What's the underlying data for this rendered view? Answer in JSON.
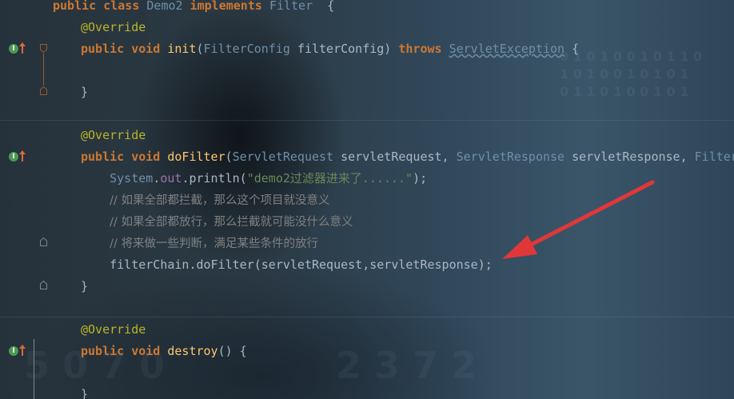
{
  "editor": {
    "lines": [
      {
        "tokens": [
          [
            "kw",
            "public "
          ],
          [
            "kw",
            "class "
          ],
          [
            "typ",
            "Demo2 "
          ],
          [
            "kw",
            "implements "
          ],
          [
            "typ",
            "Filter"
          ],
          [
            "",
            "  {"
          ]
        ]
      },
      {
        "tokens": [
          [
            "ann",
            "@Override"
          ]
        ]
      },
      {
        "tokens": [
          [
            "kw",
            "public "
          ],
          [
            "kw",
            "void "
          ],
          [
            "mth",
            "init"
          ],
          [
            "",
            "("
          ],
          [
            "typ",
            "FilterConfig "
          ],
          [
            "",
            "filterConfig) "
          ],
          [
            "kw",
            "throws "
          ],
          [
            "typ ul",
            "ServletException"
          ],
          [
            "",
            " {"
          ]
        ]
      },
      {
        "tokens": [
          [
            "",
            ""
          ]
        ]
      },
      {
        "tokens": [
          [
            "",
            "}"
          ]
        ]
      },
      {
        "tokens": [
          [
            "",
            ""
          ]
        ]
      },
      {
        "tokens": [
          [
            "ann",
            "@Override"
          ]
        ]
      },
      {
        "tokens": [
          [
            "kw",
            "public "
          ],
          [
            "kw",
            "void "
          ],
          [
            "mth",
            "doFilter"
          ],
          [
            "",
            "("
          ],
          [
            "typ",
            "ServletRequest "
          ],
          [
            "",
            "servletRequest, "
          ],
          [
            "typ",
            "ServletResponse "
          ],
          [
            "",
            "servletResponse, "
          ],
          [
            "typ",
            "FilterChain filterChain"
          ]
        ]
      },
      {
        "tokens": [
          [
            "",
            "    "
          ],
          [
            "typ",
            "System"
          ],
          [
            "",
            "."
          ],
          [
            "fld",
            "out"
          ],
          [
            "",
            ".println("
          ],
          [
            "str",
            "\"demo2过滤器进来了......\""
          ],
          [
            "",
            ");"
          ]
        ]
      },
      {
        "tokens": [
          [
            "",
            "    "
          ],
          [
            "cmt",
            "// 如果全部都拦截，那么这个项目就没意义"
          ]
        ]
      },
      {
        "tokens": [
          [
            "",
            "    "
          ],
          [
            "cmt",
            "// 如果全部都放行，那么拦截就可能没什么意义"
          ]
        ]
      },
      {
        "tokens": [
          [
            "",
            "    "
          ],
          [
            "cmt",
            "// 将来做一些判断，满足某些条件的放行"
          ]
        ]
      },
      {
        "tokens": [
          [
            "",
            "    filterChain.doFilter(servletRequest,servletResponse);"
          ]
        ]
      },
      {
        "tokens": [
          [
            "",
            "}"
          ]
        ]
      },
      {
        "tokens": [
          [
            "",
            ""
          ]
        ]
      },
      {
        "tokens": [
          [
            "ann",
            "@Override"
          ]
        ]
      },
      {
        "tokens": [
          [
            "kw",
            "public "
          ],
          [
            "kw",
            "void "
          ],
          [
            "mth",
            "destroy"
          ],
          [
            "",
            "() {"
          ]
        ]
      },
      {
        "tokens": [
          [
            "",
            ""
          ]
        ]
      },
      {
        "tokens": [
          [
            "",
            "}"
          ]
        ]
      }
    ]
  },
  "gutter": {
    "implements_icon": "implements-up-arrow-icon",
    "implements_badge": "I"
  },
  "colors": {
    "keyword": "#cc7832",
    "annotation": "#bbb529",
    "type": "#6f8fa8",
    "method": "#ffc66d",
    "field": "#9876aa",
    "string": "#6a8759",
    "comment": "#808080",
    "arrow": "#e0373a"
  }
}
